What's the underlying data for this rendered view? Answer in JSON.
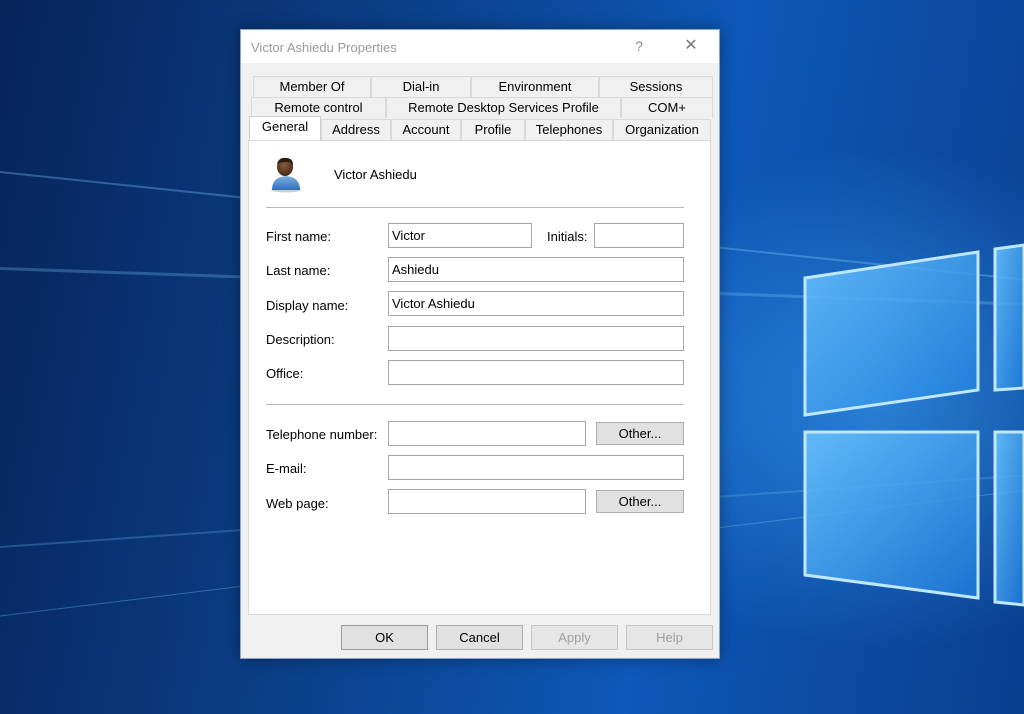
{
  "window": {
    "title": "Victor Ashiedu Properties",
    "help_glyph": "?",
    "close_glyph": "✕"
  },
  "tabs": {
    "row1": [
      "Member Of",
      "Dial-in",
      "Environment",
      "Sessions"
    ],
    "row2": [
      "Remote control",
      "Remote Desktop Services Profile",
      "COM+"
    ],
    "row3": [
      "General",
      "Address",
      "Account",
      "Profile",
      "Telephones",
      "Organization"
    ],
    "active": "General"
  },
  "general": {
    "display_heading": "Victor Ashiedu",
    "first_name_label": "First name:",
    "first_name_value": "Victor",
    "initials_label": "Initials:",
    "initials_value": "",
    "last_name_label": "Last name:",
    "last_name_value": "Ashiedu",
    "display_name_label": "Display name:",
    "display_name_value": "Victor Ashiedu",
    "description_label": "Description:",
    "description_value": "",
    "office_label": "Office:",
    "office_value": "",
    "telephone_label": "Telephone number:",
    "telephone_value": "",
    "email_label": "E-mail:",
    "email_value": "",
    "webpage_label": "Web page:",
    "webpage_value": "",
    "other_label": "Other..."
  },
  "buttons": {
    "ok": "OK",
    "cancel": "Cancel",
    "apply": "Apply",
    "help": "Help"
  },
  "colors": {
    "desktop_blue": "#0b3f88",
    "title_text": "#9a9a9a",
    "dialog_bg": "#f0f0f0"
  }
}
